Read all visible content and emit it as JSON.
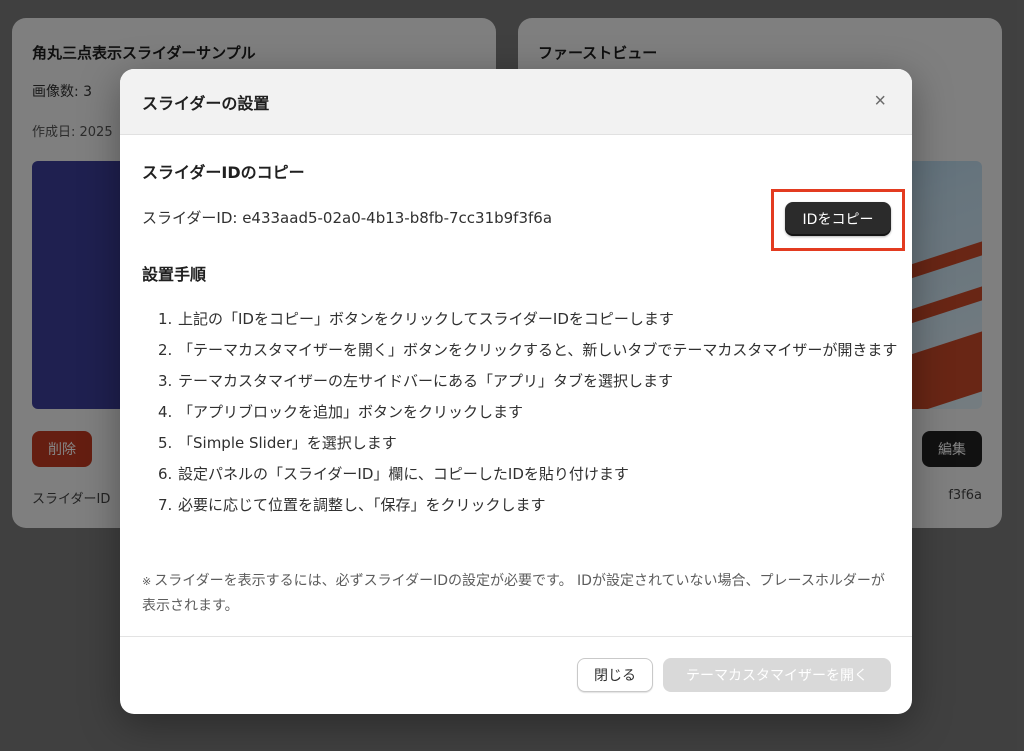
{
  "background": {
    "left_card": {
      "title": "角丸三点表示スライダーサンプル",
      "image_count": "画像数: 3",
      "created": "作成日: 2025",
      "delete_label": "削除",
      "footer": "スライダーID"
    },
    "right_card": {
      "title": "ファーストビュー",
      "edit_label": "編集",
      "footer": "f3f6a"
    }
  },
  "modal": {
    "title": "スライダーの設置",
    "close_icon": "×",
    "copy_section_title": "スライダーIDのコピー",
    "slider_id_text": "スライダーID: e433aad5-02a0-4b13-b8fb-7cc31b9f3f6a",
    "copy_button_label": "IDをコピー",
    "steps_title": "設置手順",
    "steps": [
      {
        "num": "1.",
        "text": "上記の「IDをコピー」ボタンをクリックしてスライダーIDをコピーします"
      },
      {
        "num": "2.",
        "text": "「テーマカスタマイザーを開く」ボタンをクリックすると、新しいタブでテーマカスタマイザーが開きます"
      },
      {
        "num": "3.",
        "text": "テーマカスタマイザーの左サイドバーにある「アプリ」タブを選択します"
      },
      {
        "num": "4.",
        "text": "「アプリブロックを追加」ボタンをクリックします"
      },
      {
        "num": "5.",
        "text": "「Simple Slider」を選択します"
      },
      {
        "num": "6.",
        "text": "設定パネルの「スライダーID」欄に、コピーしたIDを貼り付けます"
      },
      {
        "num": "7.",
        "text": "必要に応じて位置を調整し、「保存」をクリックします"
      }
    ],
    "note_mark": "※",
    "note_text": "スライダーを表示するには、必ずスライダーIDの設定が必要です。 IDが設定されていない場合、プレースホルダーが表示されます。",
    "close_button_label": "閉じる",
    "open_customizer_label": "テーマカスタマイザーを開く"
  },
  "colors": {
    "highlight": "#e33b20",
    "primary_button": "#2b2b2b",
    "delete_button": "#c23a22",
    "disabled_button": "#d9d9d9"
  }
}
